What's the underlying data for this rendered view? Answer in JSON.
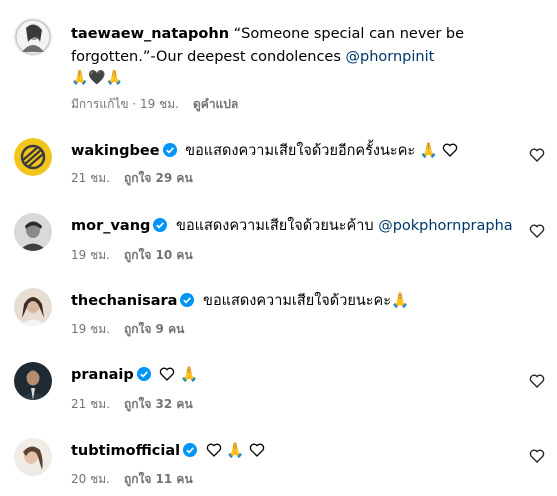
{
  "caption": {
    "username": "taewaew_natapohn",
    "text_line1": "“Someone special can never be",
    "text_line2": "forgotten.”-Our deepest condolences ",
    "mention": "@phornpinit",
    "emojis": "🙏🖤🙏",
    "edited": "มีการแก้ไข · 19 ชม.",
    "translate": "ดูคำแปล"
  },
  "comments": [
    {
      "username": "wakingbee",
      "verified": true,
      "text": "ขอแสดงความเสียใจด้วยอีกครั้งนะคะ 🙏",
      "time": "21 ชม.",
      "likes": "ถูกใจ 29 คน"
    },
    {
      "username": "mor_vang",
      "verified": true,
      "text": "ขอแสดงความเสียใจด้วยนะค้าบ ",
      "mention": "@pokphornprapha",
      "time": "19 ชม.",
      "likes": "ถูกใจ 10 คน"
    },
    {
      "username": "thechanisara",
      "verified": true,
      "text": "ขอแสดงความเสียใจด้วยนะคะ🙏",
      "time": "19 ชม.",
      "likes": "ถูกใจ 9 คน"
    },
    {
      "username": "pranaip",
      "verified": true,
      "text_after": "🙏",
      "time": "21 ชม.",
      "likes": "ถูกใจ 32 คน"
    },
    {
      "username": "tubtimofficial",
      "verified": true,
      "text_mid": "🙏",
      "time": "20 ชม.",
      "likes": "ถูกใจ 11 คน"
    }
  ],
  "colors": {
    "verified": "#0095f6",
    "meta": "#737373",
    "mention": "#00376b"
  },
  "icons": {
    "verified": "verified-badge-icon",
    "like": "heart-outline-icon"
  }
}
